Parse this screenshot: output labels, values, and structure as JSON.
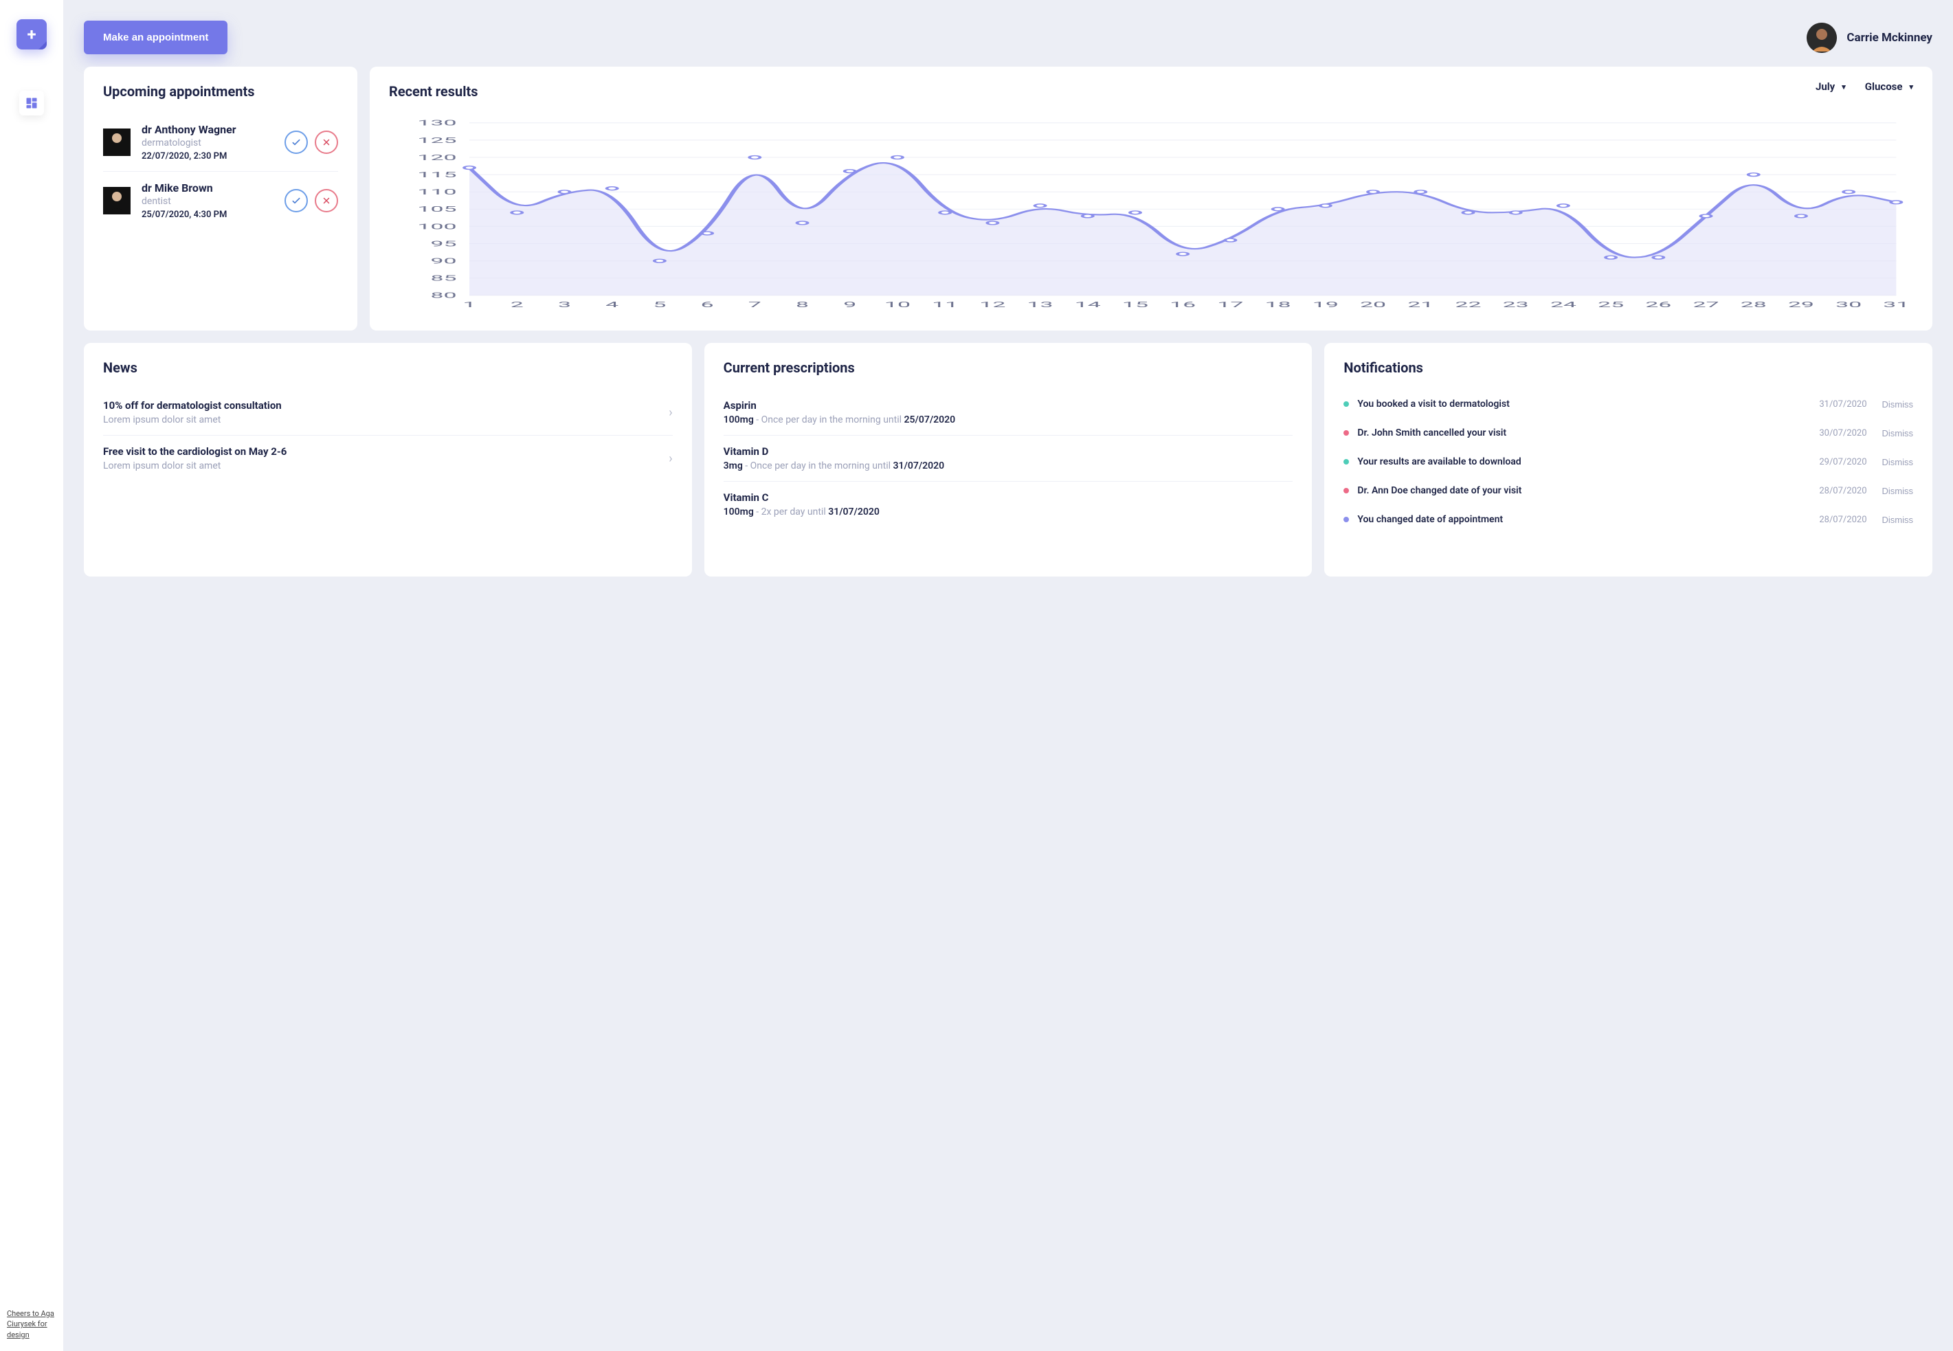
{
  "header": {
    "make_appointment_label": "Make an appointment",
    "user_name": "Carrie Mckinney"
  },
  "sidebar": {
    "credit_text": "Cheers to Aga Ciurysek for design"
  },
  "appointments": {
    "title": "Upcoming appointments",
    "items": [
      {
        "name": "dr Anthony Wagner",
        "spec": "dermatologist",
        "time": "22/07/2020, 2:30 PM"
      },
      {
        "name": "dr Mike Brown",
        "spec": "dentist",
        "time": "25/07/2020, 4:30 PM"
      }
    ]
  },
  "results": {
    "title": "Recent results",
    "month_selected": "July",
    "metric_selected": "Glucose"
  },
  "chart_data": {
    "type": "area",
    "title": "Recent results",
    "xlabel": "",
    "ylabel": "",
    "ylim": [
      80,
      130
    ],
    "y_ticks": [
      80,
      85,
      90,
      95,
      100,
      105,
      110,
      115,
      120,
      125,
      130
    ],
    "x": [
      1,
      2,
      3,
      4,
      5,
      6,
      7,
      8,
      9,
      10,
      11,
      12,
      13,
      14,
      15,
      16,
      17,
      18,
      19,
      20,
      21,
      22,
      23,
      24,
      25,
      26,
      27,
      28,
      29,
      30,
      31
    ],
    "values": [
      117,
      104,
      110,
      111,
      90,
      98,
      120,
      101,
      116,
      120,
      104,
      101,
      106,
      103,
      104,
      92,
      96,
      105,
      106,
      110,
      110,
      104,
      104,
      106,
      91,
      91,
      103,
      115,
      103,
      110,
      107
    ]
  },
  "news": {
    "title": "News",
    "items": [
      {
        "title": "10% off for dermatologist consultation",
        "sub": "Lorem ipsum dolor sit amet"
      },
      {
        "title": "Free visit to the cardiologist on May 2-6",
        "sub": "Lorem ipsum dolor sit amet"
      }
    ]
  },
  "prescriptions": {
    "title": "Current prescriptions",
    "items": [
      {
        "name": "Aspirin",
        "dose": "100mg",
        "schedule": "Once per day in the morning until",
        "until": "25/07/2020"
      },
      {
        "name": "Vitamin D",
        "dose": "3mg",
        "schedule": "Once per day in the morning until",
        "until": "31/07/2020"
      },
      {
        "name": "Vitamin C",
        "dose": "100mg",
        "schedule": "2x per day until",
        "until": "31/07/2020"
      }
    ]
  },
  "notifications": {
    "title": "Notifications",
    "dismiss_label": "Dismiss",
    "items": [
      {
        "color": "green",
        "msg": "You booked a visit to dermatologist",
        "date": "31/07/2020"
      },
      {
        "color": "red",
        "msg": "Dr. John Smith cancelled your visit",
        "date": "30/07/2020"
      },
      {
        "color": "green",
        "msg": "Your results are available to download",
        "date": "29/07/2020"
      },
      {
        "color": "red",
        "msg": "Dr. Ann Doe changed date of your visit",
        "date": "28/07/2020"
      },
      {
        "color": "purple",
        "msg": "You changed date of appointment",
        "date": "28/07/2020"
      }
    ]
  }
}
